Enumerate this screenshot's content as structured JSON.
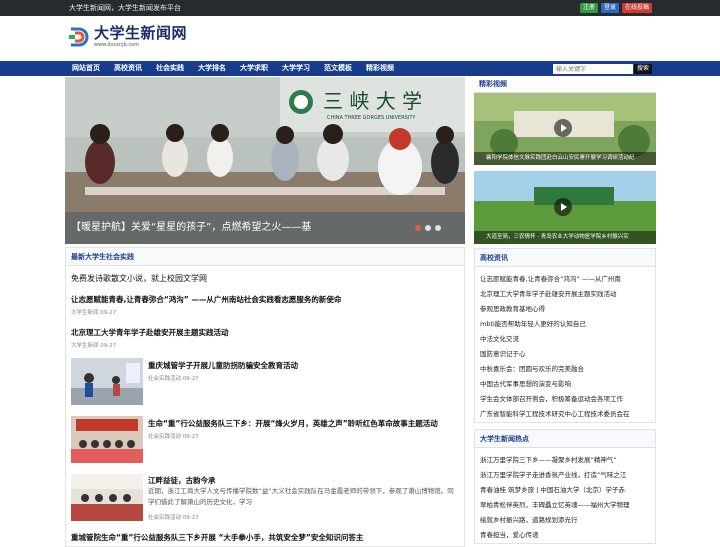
{
  "topbar": {
    "slogan": "大学生新闻网，大学生新闻发布平台",
    "register": "注册",
    "login": "登录",
    "submit": "在线投稿"
  },
  "header": {
    "site_name": "大学生新闻网",
    "site_url": "www.dxsxnjb.com",
    "logo_icon": "dx-logo-icon"
  },
  "nav": {
    "items": [
      "网站首页",
      "高校资讯",
      "社会实践",
      "大学排名",
      "大学求职",
      "大学学习",
      "范文模板",
      "精彩视频"
    ],
    "search_placeholder": "输入关键字",
    "search_button": "搜索"
  },
  "slider": {
    "caption": "【暖星护航】关爱“星星的孩子”，点燃希望之火——基",
    "sign_text": "三 峡 大 学",
    "sign_en": "CHINA THREE GORGES UNIVERSITY"
  },
  "latest": {
    "title": "最新大学生社会实践",
    "items": [
      {
        "title": "免费发诗歌散文小说，就上校园文学网"
      },
      {
        "title": "让志愿赋能青春,让青春弥合“鸿沟” ——从广州南站社会实践看志愿服务的新使命",
        "meta": "大学生新闻 09-27"
      },
      {
        "title": "北京理工大学青年学子赴雄安开展主题实践活动",
        "meta": "大学生新闻 09-27"
      },
      {
        "title": "重庆城管学子开展儿童防拐防骗安全教育活动",
        "meta": "社会实践活动 09-27"
      },
      {
        "title": "生命“重”行公益服务队三下乡：开展“烽火岁月，英雄之声”聆听红色革命故事主题活动",
        "meta": "社会实践活动 09-27"
      },
      {
        "title": "江畔益徒，古韵今承",
        "desc": "近期，浙江工商大学人文与传播学院数“益”大义社会实践队在马金霞老师的带领下，参观了萧山博物馆。同学们借此了解萧山的历史文化，学习",
        "meta": "社会实践活动 09-27"
      },
      {
        "title": "重城管院生命“重”行公益服务队三下乡开展 “大手拳小手，共筑安全梦”安全知识问答主"
      }
    ]
  },
  "videos": {
    "title": "精彩视频",
    "items": [
      {
        "caption": "襄阳学院体信文脉实践团赴白云山安民寨开展学习调研活动纪"
      },
      {
        "caption": "大道至简，三农情怀 · 青岛农业大学动物医学院乡村振兴实"
      }
    ]
  },
  "campus": {
    "title": "高校资讯",
    "items": [
      "让志愿赋能青春,让青春弥合“鸿沟” ——从广州南",
      "北京理工大学青年学子赴雄安开展主题实践活动",
      "参观思政教育基地心得",
      "mbti能否帮助年轻人更好的认知自己",
      "中法文化交流",
      "国防意识记于心",
      "中秋喜乐会：团圆与欢乐的完美融合",
      "中国古代军事思想的演变与影响",
      "学生会文体部召开例会，积极筹备运动会各项工作",
      "广东省智能科学工程技术研究中心工程技术委员会在"
    ]
  },
  "hot": {
    "title": "大学生新闻热点",
    "items": [
      "浙江万里学院三下乡——凝聚乡村发展“精神气”",
      "浙江万里学院学子走进香氛产业线，打造“气味之江",
      "青春油桂 筑梦乡旅 | 中国石油大学（北京）学子赤",
      "翠柏青松伴英烈，丰碑矗立忆英魂——福州大学物理",
      "绘就乡村振兴路，道路规划添光行",
      "青春担当，爱心传递"
    ]
  }
}
